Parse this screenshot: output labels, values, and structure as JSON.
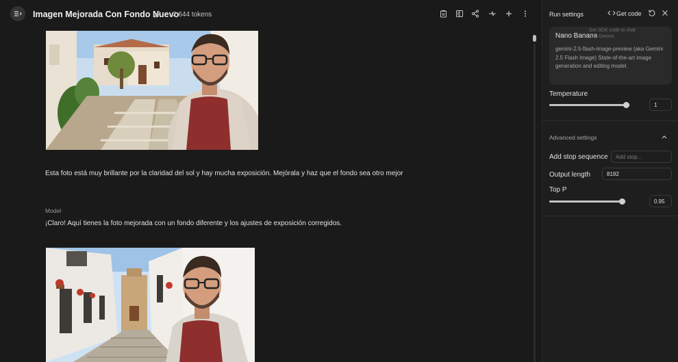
{
  "header": {
    "title": "Imagen Mejorada Con Fondo Nuevo",
    "tokens": "2,644 tokens",
    "icons": [
      "menu-icon",
      "edit-icon",
      "clipboard-icon",
      "compare-icon",
      "share-icon",
      "compare-arrows-icon",
      "add-icon",
      "more-vert-icon"
    ]
  },
  "chat": {
    "user_message": "Esta foto está muy brillante por la claridad del sol y hay mucha exposición. Mejórala y haz que el fondo sea otro mejor",
    "model_label": "Model",
    "model_message": "¡Claro! Aquí tienes la foto mejorada con un fondo diferente y los ajustes de exposición corregidos."
  },
  "panel": {
    "title": "Run settings",
    "get_code": "Get code",
    "tooltip": "Get SDK code to chat with Gemini",
    "model": {
      "name": "Nano Banana",
      "description": "gemini-2.5-flash-image-preview (aka Gemini 2.5 Flash Image) State-of-the-art image generation and editing model."
    },
    "temperature": {
      "label": "Temperature",
      "value": "1",
      "fraction": 0.95
    },
    "advanced": {
      "label": "Advanced settings"
    },
    "stop_sequence": {
      "label": "Add stop sequence",
      "placeholder": "Add stop..."
    },
    "output_length": {
      "label": "Output length",
      "value": "8192"
    },
    "top_p": {
      "label": "Top P",
      "value": "0.95",
      "fraction": 0.95
    }
  },
  "colors": {
    "background": "#1a1a1a",
    "panel": "#1e1e1e",
    "card": "#2a2a2a",
    "text": "#e3e3e3"
  }
}
